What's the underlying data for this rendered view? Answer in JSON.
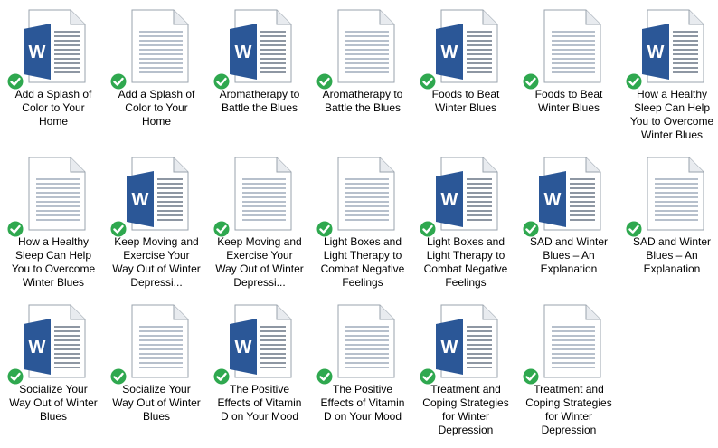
{
  "colors": {
    "word_blue": "#2b5797",
    "check_green": "#2fa84f",
    "page_line": "#b7c0cc"
  },
  "icons": {
    "word_doc": "word-document-icon",
    "plain_doc": "text-document-icon",
    "sync": "sync-checkmark-icon",
    "word_letter": "W"
  },
  "files": [
    {
      "name": "Add a Splash of Color to Your Home",
      "type": "word"
    },
    {
      "name": "Add a Splash of Color to Your Home",
      "type": "plain"
    },
    {
      "name": "Aromatherapy to Battle the Blues",
      "type": "word"
    },
    {
      "name": "Aromatherapy to Battle the Blues",
      "type": "plain"
    },
    {
      "name": "Foods to Beat Winter Blues",
      "type": "word"
    },
    {
      "name": "Foods to Beat Winter Blues",
      "type": "plain"
    },
    {
      "name": "How a Healthy Sleep Can Help You to Overcome Winter Blues",
      "type": "word"
    },
    {
      "name": "How a Healthy Sleep Can Help You to Overcome Winter Blues",
      "type": "plain"
    },
    {
      "name": "Keep Moving and Exercise Your Way Out of Winter Depressi...",
      "type": "word"
    },
    {
      "name": "Keep Moving and Exercise Your Way Out of Winter Depressi...",
      "type": "plain"
    },
    {
      "name": "Light Boxes and Light Therapy to Combat Negative Feelings",
      "type": "plain"
    },
    {
      "name": "Light Boxes and Light Therapy to Combat Negative Feelings",
      "type": "word"
    },
    {
      "name": "SAD and Winter Blues – An Explanation",
      "type": "word"
    },
    {
      "name": "SAD and Winter Blues – An Explanation",
      "type": "plain"
    },
    {
      "name": "Socialize Your Way Out of Winter Blues",
      "type": "word"
    },
    {
      "name": "Socialize Your Way Out of Winter Blues",
      "type": "plain"
    },
    {
      "name": "The Positive Effects of Vitamin D on Your Mood",
      "type": "word"
    },
    {
      "name": "The Positive Effects of Vitamin D on Your Mood",
      "type": "plain"
    },
    {
      "name": "Treatment and Coping Strategies for Winter Depression",
      "type": "word"
    },
    {
      "name": "Treatment and Coping Strategies for Winter Depression",
      "type": "plain"
    }
  ]
}
